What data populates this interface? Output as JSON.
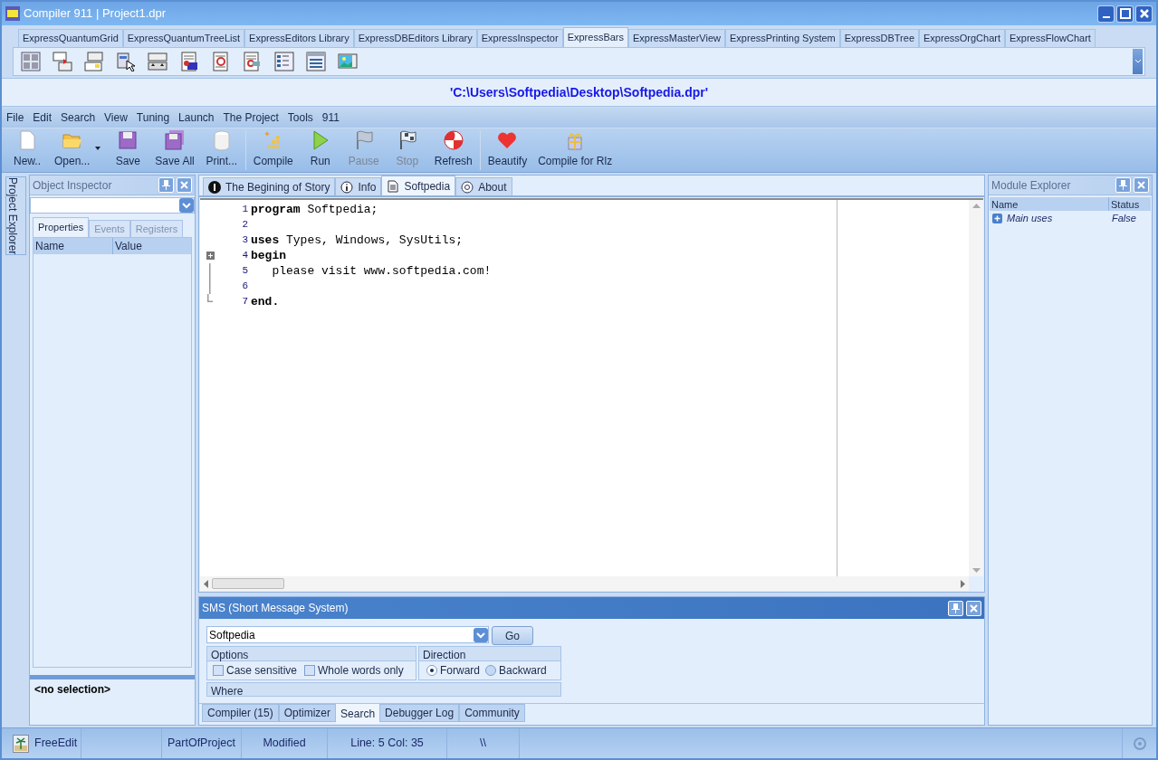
{
  "window": {
    "title": "Compiler 911 | Project1.dpr"
  },
  "palette": {
    "tabs": [
      {
        "label": "ExpressQuantumGrid",
        "selected": false
      },
      {
        "label": "ExpressQuantumTreeList",
        "selected": false
      },
      {
        "label": "ExpressEditors Library",
        "selected": false
      },
      {
        "label": "ExpressDBEditors Library",
        "selected": false
      },
      {
        "label": "ExpressInspector",
        "selected": false
      },
      {
        "label": "ExpressBars",
        "selected": true
      },
      {
        "label": "ExpressMasterView",
        "selected": false
      },
      {
        "label": "ExpressPrinting System",
        "selected": false
      },
      {
        "label": "ExpressDBTree",
        "selected": false
      },
      {
        "label": "ExpressOrgChart",
        "selected": false
      },
      {
        "label": "ExpressFlowChart",
        "selected": false
      }
    ]
  },
  "path_bar": {
    "text": "'C:\\Users\\Softpedia\\Desktop\\Softpedia.dpr'"
  },
  "menu": [
    "File",
    "Edit",
    "Search",
    "View",
    "Tuning",
    "Launch",
    "The Project",
    "Tools",
    "911"
  ],
  "toolbar": {
    "groups": [
      [
        {
          "label": "New..",
          "kind": "new",
          "disabled": false
        },
        {
          "label": "Open...",
          "kind": "open",
          "disabled": false
        },
        {
          "label": "Save",
          "kind": "save",
          "disabled": false
        },
        {
          "label": "Save All",
          "kind": "saveall",
          "disabled": false
        },
        {
          "label": "Print...",
          "kind": "print",
          "disabled": false
        }
      ],
      [
        {
          "label": "Compile",
          "kind": "compile",
          "disabled": false
        },
        {
          "label": "Run",
          "kind": "run",
          "disabled": false
        },
        {
          "label": "Pause",
          "kind": "pause",
          "disabled": true
        },
        {
          "label": "Stop",
          "kind": "stop",
          "disabled": true
        },
        {
          "label": "Refresh",
          "kind": "refresh",
          "disabled": false
        }
      ],
      [
        {
          "label": "Beautify",
          "kind": "beautify",
          "disabled": false
        },
        {
          "label": "Compile for Rlz",
          "kind": "release",
          "disabled": false
        }
      ]
    ]
  },
  "side_tabs": [
    "Project Explorer"
  ],
  "object_inspector": {
    "title": "Object Inspector",
    "tabs": [
      {
        "label": "Properties",
        "selected": true,
        "disabled": false
      },
      {
        "label": "Events",
        "selected": false,
        "disabled": true
      },
      {
        "label": "Registers",
        "selected": false,
        "disabled": true
      }
    ],
    "columns": [
      "Name",
      "Value"
    ],
    "footer": "<no selection>"
  },
  "editor": {
    "tabs": [
      {
        "label": "The Begining of Story",
        "kind": "number",
        "selected": false
      },
      {
        "label": "Info",
        "kind": "info",
        "selected": false
      },
      {
        "label": "Softpedia",
        "kind": "document",
        "selected": true
      },
      {
        "label": "About",
        "kind": "at",
        "selected": false
      }
    ],
    "lines": [
      {
        "number": "1",
        "text": "**program** Softpedia;",
        "kind": "plain"
      },
      {
        "number": "2",
        "kind": "plain"
      },
      {
        "number": "3",
        "text": "**uses** Types, Windows, SysUtils;",
        "kind": "plain"
      },
      {
        "number": "4",
        "text": "**begin**",
        "kind": "fold_start"
      },
      {
        "number": "5",
        "text": "   please visit www.softpedia.com!",
        "kind": "fold_line"
      },
      {
        "number": "6",
        "kind": "fold_line"
      },
      {
        "number": "7",
        "text": "**end.**",
        "kind": "fold_end"
      }
    ]
  },
  "sms": {
    "title": "SMS (Short Message System)",
    "search_value": "Softpedia",
    "go": "Go",
    "options": {
      "title": "Options",
      "items": [
        {
          "label": "Case sensitive",
          "checked": false
        },
        {
          "label": "Whole words only",
          "checked": false
        }
      ]
    },
    "direction": {
      "title": "Direction",
      "items": [
        {
          "label": "Forward",
          "selected": true
        },
        {
          "label": "Backward",
          "selected": false
        }
      ]
    },
    "where": {
      "title": "Where"
    },
    "tabs": [
      {
        "label": "Compiler (15)",
        "selected": false
      },
      {
        "label": "Optimizer",
        "selected": false
      },
      {
        "label": "Search",
        "selected": true
      },
      {
        "label": "Debugger Log",
        "selected": false
      },
      {
        "label": "Community",
        "selected": false
      }
    ]
  },
  "module_explorer": {
    "title": "Module Explorer",
    "columns": [
      "Name",
      "Status"
    ],
    "rows": [
      {
        "name": "Main uses",
        "status": "False",
        "expanded": false
      }
    ]
  },
  "status_bar": [
    "FreeEdit",
    "PartOfProject",
    "Modified",
    "Line: 5 Col: 35",
    "\\\\"
  ]
}
